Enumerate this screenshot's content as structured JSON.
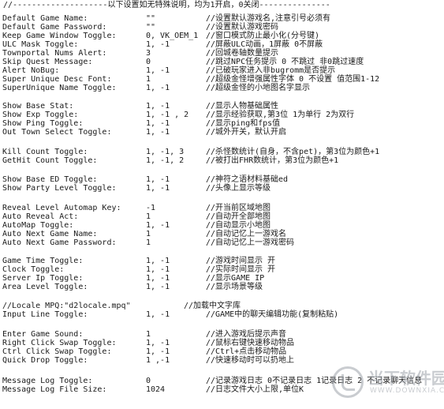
{
  "header": "//--------------------以下设置如无特殊说明，均为1开启，0关闭---------------",
  "rows": [
    {
      "key": "Default Game Name:",
      "val": "\"\"",
      "comment": "//设置默认游戏名,注意引号必须有"
    },
    {
      "key": "Default Game Password:",
      "val": "\"\"",
      "comment": "//设置默认游戏密码"
    },
    {
      "key": "Keep Game Window Toggle:",
      "val": "0, VK_OEM_1",
      "comment": "//窗口模式防止最小化(分号键)"
    },
    {
      "key": "ULC Mask Toggle:",
      "val": "1, -1",
      "comment": "//屏蔽ULC动画，1屏蔽 0不屏蔽"
    },
    {
      "key": "Townportal Nums Alert:",
      "val": "3",
      "comment": "//回城卷轴数量提示"
    },
    {
      "key": "Skip Quest Message:",
      "val": "0",
      "comment": "//跳过NPC任务提示 0 不跳过 非0跳过速度"
    },
    {
      "key": "Alert NoBug:",
      "val": "1, -1",
      "comment": "//已破玩家进入非bugromm是否提示"
    },
    {
      "key": "Super Unique Desc Font:",
      "val": "1",
      "comment": "//超级金怪增强属性字体 0 不设置 值范围1-12"
    },
    {
      "key": "SuperUnique Name Toggle:",
      "val": "1, -1",
      "comment": "//超级金怪的小地图名字显示"
    },
    {
      "key": "Show Base Stat:",
      "val": "1, -1",
      "comment": "//显示人物基础属性"
    },
    {
      "key": "Show Exp Toggle:",
      "val": "1, -1 , 2",
      "comment": "//显示经验获取,第3位 1为单行 2为双行"
    },
    {
      "key": "Show Ping Toggle:",
      "val": "1, -1",
      "comment": "//显示ping和fps值"
    },
    {
      "key": "Out Town Select Toggle:",
      "val": "1, -1",
      "comment": "//城外开关，默认开启"
    },
    {
      "key": "Kill Count Toggle:",
      "val": "1, -1, 3",
      "comment": "//杀怪数统计(自身，不含pet)，第3位为颜色+1"
    },
    {
      "key": "GetHit Count Toggle:",
      "val": "1, -1, 2",
      "comment": "//被打出FHR数统计，第3位为颜色+1"
    },
    {
      "key": "Show Base ED Toggle:",
      "val": "1, -1",
      "comment": "//神符之语材料基础ed"
    },
    {
      "key": "Show Party Level Toggle:",
      "val": "1, -1",
      "comment": "//头像上显示等级"
    },
    {
      "key": "Reveal Level Automap Key:",
      "val": "-1",
      "comment": "//开当前区域地图"
    },
    {
      "key": "Auto Reveal Act:",
      "val": "1",
      "comment": "//自动开全部地图"
    },
    {
      "key": "AutoMap Toggle:",
      "val": "1, -1",
      "comment": "//自动显示小地图"
    },
    {
      "key": "Auto Next Game Name:",
      "val": "1",
      "comment": "//自动记忆上一游戏名"
    },
    {
      "key": "Auto Next Game Password:",
      "val": "1",
      "comment": "//自动记忆上一游戏密码"
    },
    {
      "key": "Game Time Toggle:",
      "val": "1, -1",
      "comment": "//游戏时间显示 开"
    },
    {
      "key": "Clock Toggle:",
      "val": "1, -1",
      "comment": "//实际时间显示 开"
    },
    {
      "key": "Server Ip Toggle:",
      "val": "1, -1",
      "comment": "//显示GAME IP"
    },
    {
      "key": "Area Level Toggle:",
      "val": "1, -1",
      "comment": "//显示场景等级"
    },
    {
      "key": "//Locale MPQ:\"d2locale.mpq\"",
      "val": "",
      "comment": "//加载中文字库"
    },
    {
      "key": "Input Line Toggle:",
      "val": "1, -1",
      "comment": "//GAME中的聊天编辑功能(复制粘贴)"
    },
    {
      "key": "Enter Game Sound:",
      "val": "1",
      "comment": "//进入游戏后提示声音"
    },
    {
      "key": "Right Click Swap Toggle:",
      "val": "1, -1",
      "comment": "//鼠标右键快速移动物品"
    },
    {
      "key": "Ctrl Click Swap Toggle:",
      "val": "1, -1",
      "comment": "//Ctrl+点击移动物品"
    },
    {
      "key": "Quick Drop Toggle:",
      "val": "1 ,-1",
      "comment": "//快速移动时可以扔地上"
    },
    {
      "key": "Message Log Toggle:",
      "val": "0",
      "comment": "//记录游戏日志 0不记录日志 1记录日志 2 不记录聊天信息"
    },
    {
      "key": "Message Log File Size:",
      "val": "1024",
      "comment": "//日志文件大小上限,单位K"
    }
  ],
  "watermark": {
    "text": "当下软件园",
    "sub": "WWW.DOWNXIA.COM"
  }
}
